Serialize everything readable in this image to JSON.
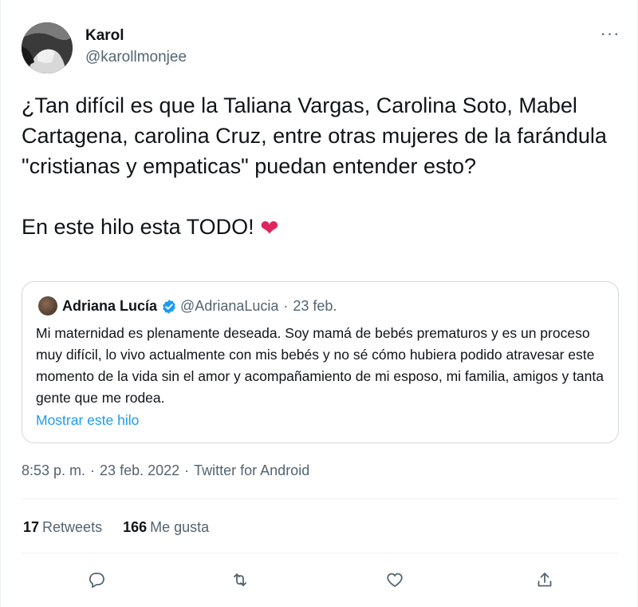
{
  "author": {
    "name": "Karol",
    "handle": "@karollmonjee"
  },
  "more_icon": "more-horizontal-icon",
  "tweet": {
    "paragraph_1": "¿Tan difícil es que la Taliana Vargas, Carolina Soto, Mabel Cartagena, carolina Cruz, entre otras mujeres de la farándula \"cristianas y empaticas\" puedan entender esto?",
    "paragraph_2": "En este hilo esta TODO!",
    "emoji": "❤️"
  },
  "quoted_tweet": {
    "name": "Adriana Lucía",
    "verified": true,
    "handle": "@AdrianaLucia",
    "separator": "·",
    "date": "23 feb.",
    "text": "Mi maternidad es plenamente deseada. Soy mamá de bebés prematuros y es un proceso muy difícil, lo vivo actualmente con mis bebés y no sé cómo hubiera podido atravesar este momento de la vida sin el amor y acompañamiento de mi esposo, mi familia, amigos y tanta gente que me rodea.",
    "show_thread": "Mostrar este hilo"
  },
  "meta": {
    "time": "8:53 p. m.",
    "separator": "·",
    "date": "23 feb. 2022",
    "source": "Twitter for Android"
  },
  "stats": {
    "retweets_count": "17",
    "retweets_label": "Retweets",
    "likes_count": "166",
    "likes_label": "Me gusta"
  },
  "actions": [
    "reply-icon",
    "retweet-icon",
    "like-icon",
    "share-icon"
  ],
  "colors": {
    "text_primary": "#0f1419",
    "text_secondary": "#536471",
    "link": "#1d9bf0",
    "heart": "#e0245e",
    "border": "#cfd9de"
  }
}
